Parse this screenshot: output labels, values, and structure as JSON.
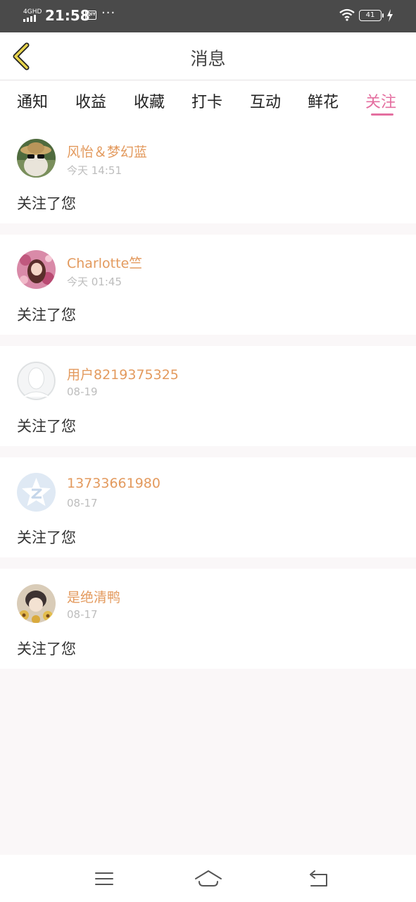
{
  "status_bar": {
    "network": "4GHD",
    "time": "21:58",
    "app_icon_text": "iQIY",
    "dots": "···",
    "battery": "41"
  },
  "header": {
    "title": "消息",
    "back_icon": "chevron-left-icon"
  },
  "tabs": [
    {
      "label": "通知",
      "active": false
    },
    {
      "label": "收益",
      "active": false
    },
    {
      "label": "收藏",
      "active": false
    },
    {
      "label": "打卡",
      "active": false
    },
    {
      "label": "互动",
      "active": false
    },
    {
      "label": "鲜花",
      "active": false
    },
    {
      "label": "关注",
      "active": true
    }
  ],
  "notifications": [
    {
      "username": "风怡＆梦幻蓝",
      "time": "今天 14:51",
      "message": "关注了您"
    },
    {
      "username": "Charlotte竺",
      "time": "今天 01:45",
      "message": "关注了您"
    },
    {
      "username": "用户8219375325",
      "time": "08-19",
      "message": "关注了您"
    },
    {
      "username": "13733661980",
      "time": "08-17",
      "message": "关注了您"
    },
    {
      "username": "是绝清鸭",
      "time": "08-17",
      "message": "关注了您"
    }
  ],
  "colors": {
    "accent": "#e46fa0",
    "username": "#e39a5e",
    "timestamp": "#bdbdbd",
    "back_icon": "#e8d44d"
  },
  "nav": {
    "menu_icon": "menu-icon",
    "home_icon": "home-icon",
    "back_icon": "back-arrow-icon"
  }
}
